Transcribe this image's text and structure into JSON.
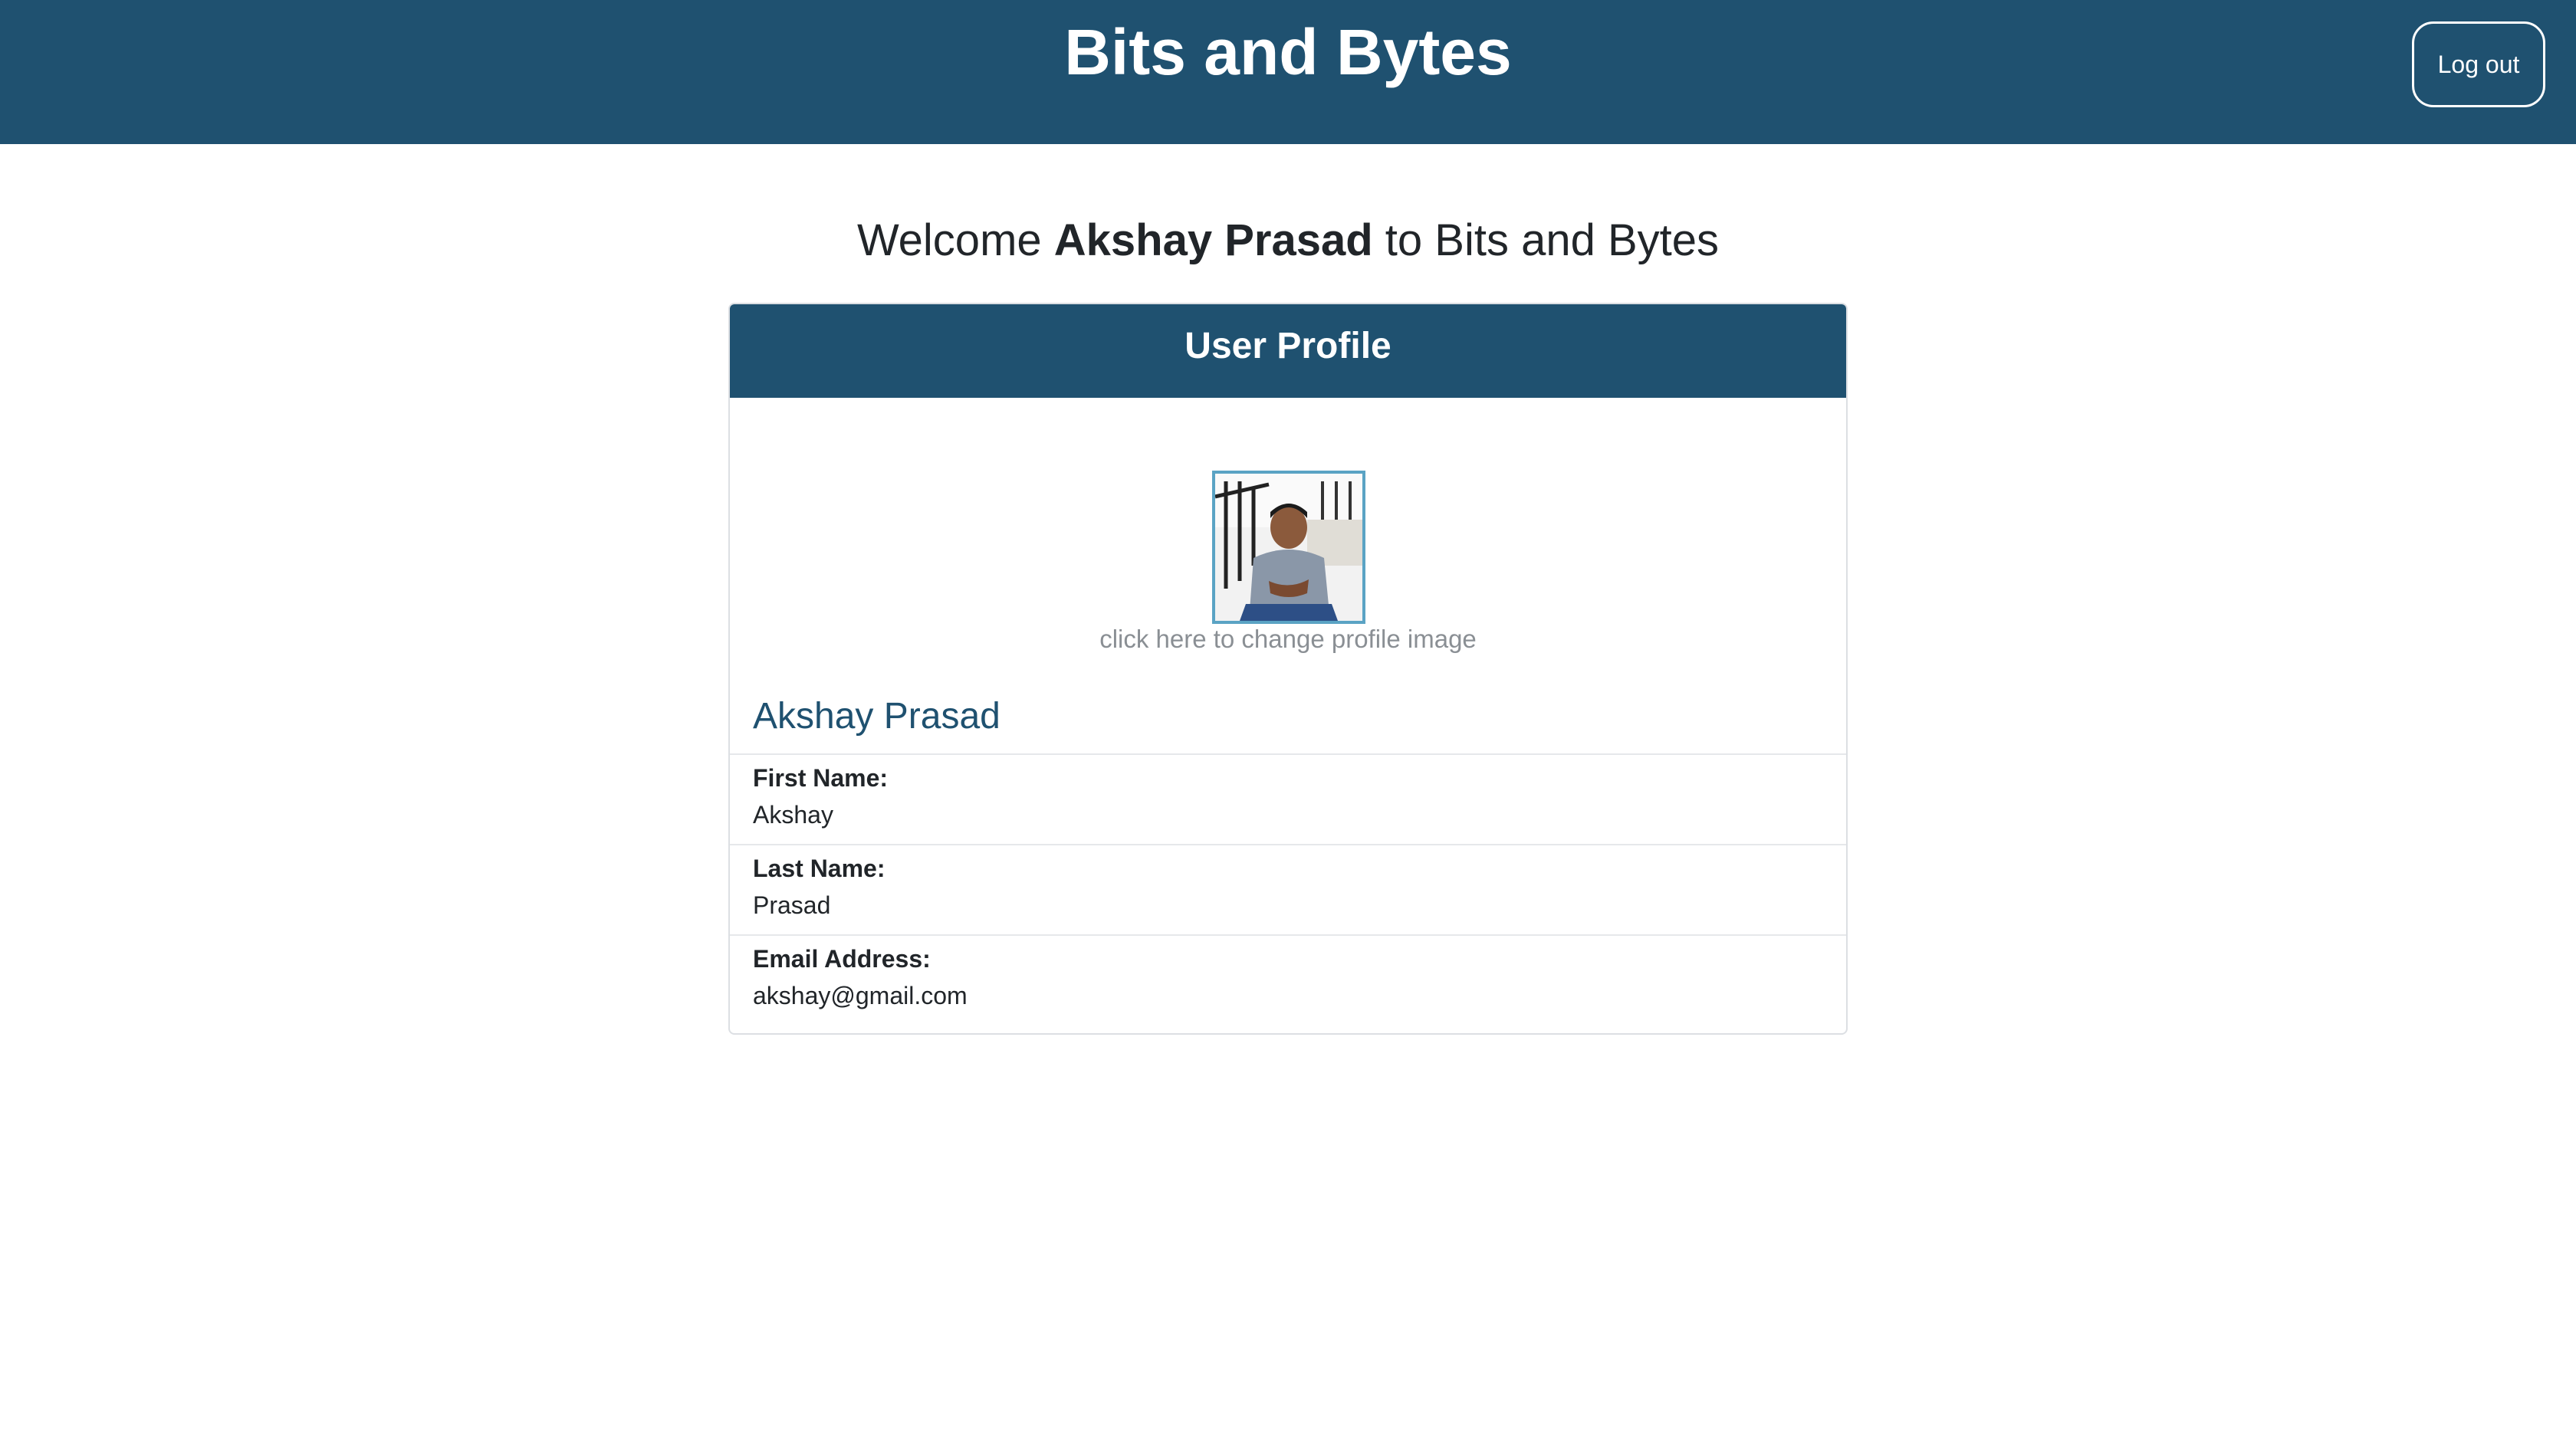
{
  "navbar": {
    "brand": "Bits and Bytes",
    "logout_label": "Log out"
  },
  "welcome": {
    "prefix": "Welcome ",
    "user_name": "Akshay Prasad",
    "suffix": " to Bits and Bytes"
  },
  "profile_card": {
    "header": "User Profile",
    "change_image_text": "click here to change profile image",
    "full_name": "Akshay Prasad",
    "fields": [
      {
        "label": "First Name:",
        "value": "Akshay"
      },
      {
        "label": "Last Name:",
        "value": "Prasad"
      },
      {
        "label": "Email Address:",
        "value": "akshay@gmail.com"
      }
    ]
  },
  "colors": {
    "brand": "#1f5170",
    "avatar_border": "#5aa3c4",
    "muted_text": "#8a8f94"
  }
}
